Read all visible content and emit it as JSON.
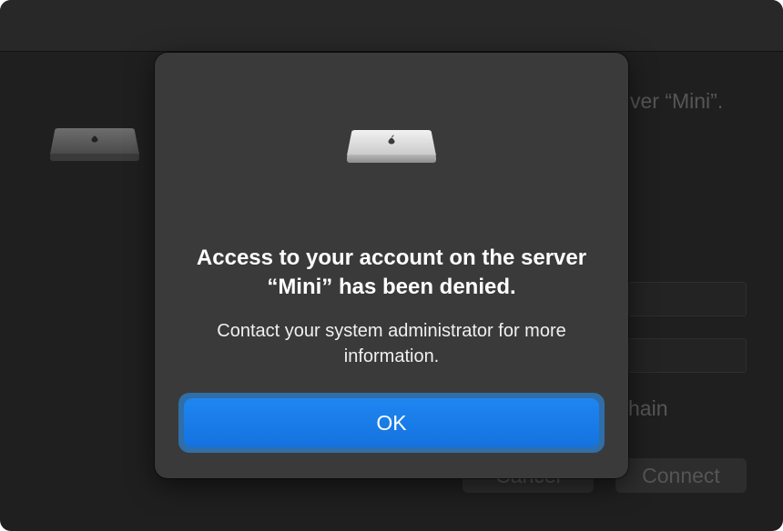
{
  "background": {
    "server_line_partial": "ver “Mini”.",
    "keychain_partial": "hain",
    "cancel_label": "Cancel",
    "connect_label": "Connect"
  },
  "dialog": {
    "icon": "mac-mini-icon",
    "title": "Access to your account on the server “Mini” has been denied.",
    "message": "Contact your system administrator for more information.",
    "ok_label": "OK"
  },
  "colors": {
    "accent": "#1A7CEB",
    "dialog_bg": "#3A3A3A",
    "window_bg": "#1F1F1F"
  }
}
